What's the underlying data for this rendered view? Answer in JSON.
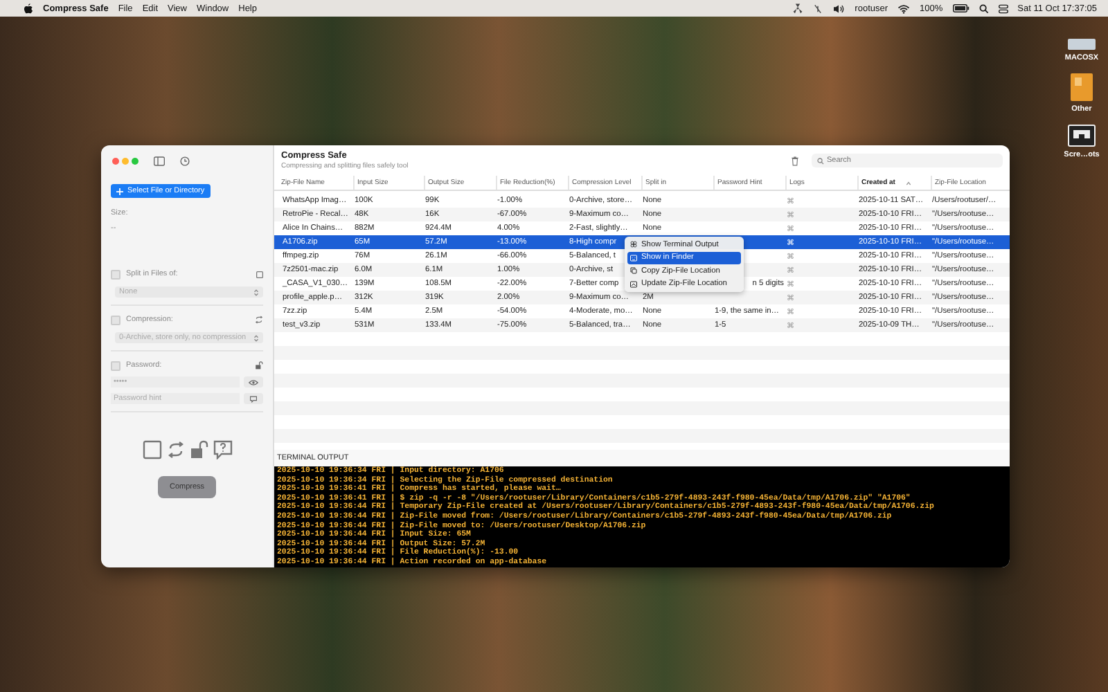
{
  "menubar": {
    "app_name": "Compress Safe",
    "menus": [
      "File",
      "Edit",
      "View",
      "Window",
      "Help"
    ],
    "user": "rootuser",
    "battery": "100%",
    "clock": "Sat 11 Oct  17:37:05"
  },
  "desktop_icons": [
    {
      "label": "MACOSX"
    },
    {
      "label": "Other"
    },
    {
      "label": "Scre…ots"
    }
  ],
  "sidebar": {
    "select_button": "Select File or Directory",
    "size_label": "Size:",
    "size_value": "--",
    "options": [
      {
        "kind": "dropdown",
        "label": "Split in Files of:",
        "checked": false,
        "value": "None"
      },
      {
        "kind": "dropdown",
        "label": "Compression:",
        "checked": false,
        "value": "0-Archive, store only, no compression"
      },
      {
        "kind": "password",
        "label": "Password:",
        "checked": false,
        "placeholder": "•••••",
        "hint_placeholder": "Password hint"
      }
    ],
    "compress_button": {
      "label": "Compress",
      "disabled": true
    }
  },
  "main": {
    "title": "Compress Safe",
    "subtitle": "Compressing and splitting files safely tool",
    "search": {
      "placeholder": "Search"
    },
    "columns": [
      {
        "label": "Zip-File Name",
        "sorted": false
      },
      {
        "label": "Input Size",
        "sorted": false
      },
      {
        "label": "Output Size",
        "sorted": false
      },
      {
        "label": "File Reduction(%)",
        "sorted": false
      },
      {
        "label": "Compression Level",
        "sorted": false
      },
      {
        "label": "Split in",
        "sorted": false
      },
      {
        "label": "Password Hint",
        "sorted": false
      },
      {
        "label": "Logs",
        "sorted": false
      },
      {
        "label": "Created at",
        "sorted": true
      },
      {
        "label": "Zip-File Location",
        "sorted": false
      }
    ],
    "rows": [
      {
        "selected": false,
        "cells": [
          "WhatsApp Imag…",
          "100K",
          "99K",
          "-1.00%",
          "0-Archive, store…",
          "None",
          null,
          "⌘",
          "2025-10-11 SAT…",
          "/Users/rootuser/…"
        ]
      },
      {
        "selected": false,
        "cells": [
          "RetroPie - Recal…",
          "48K",
          "16K",
          "-67.00%",
          "9-Maximum co…",
          "None",
          null,
          "⌘",
          "2025-10-10 FRI…",
          "\"/Users/rootuse…"
        ]
      },
      {
        "selected": false,
        "cells": [
          "Alice In Chains…",
          "882M",
          "924.4M",
          "4.00%",
          "2-Fast, slightly…",
          "None",
          null,
          "⌘",
          "2025-10-10 FRI…",
          "\"/Users/rootuse…"
        ]
      },
      {
        "selected": true,
        "cells": [
          "A1706.zip",
          "65M",
          "57.2M",
          "-13.00%",
          "8-High compr",
          null,
          null,
          "⌘",
          "2025-10-10 FRI…",
          "\"/Users/rootuse…"
        ]
      },
      {
        "selected": false,
        "cells": [
          "ffmpeg.zip",
          "76M",
          "26.1M",
          "-66.00%",
          "5-Balanced, t",
          null,
          null,
          "⌘",
          "2025-10-10 FRI…",
          "\"/Users/rootuse…"
        ]
      },
      {
        "selected": false,
        "cells": [
          "7z2501-mac.zip",
          "6.0M",
          "6.1M",
          "1.00%",
          "0-Archive, st",
          null,
          null,
          "⌘",
          "2025-10-10 FRI…",
          "\"/Users/rootuse…"
        ]
      },
      {
        "selected": false,
        "cells": [
          "_CASA_V1_030…",
          "139M",
          "108.5M",
          "-22.00%",
          "7-Better comp",
          null,
          "n 5 digits",
          "⌘",
          "2025-10-10 FRI…",
          "\"/Users/rootuse…"
        ]
      },
      {
        "selected": false,
        "cells": [
          "profile_apple.p…",
          "312K",
          "319K",
          "2.00%",
          "9-Maximum co…",
          "2M",
          null,
          "⌘",
          "2025-10-10 FRI…",
          "\"/Users/rootuse…"
        ]
      },
      {
        "selected": false,
        "cells": [
          "7zz.zip",
          "5.4M",
          "2.5M",
          "-54.00%",
          "4-Moderate, mo…",
          "None",
          "1-9, the same in…",
          "⌘",
          "2025-10-10 FRI…",
          "\"/Users/rootuse…"
        ]
      },
      {
        "selected": false,
        "cells": [
          "test_v3.zip",
          "531M",
          "133.4M",
          "-75.00%",
          "5-Balanced, tra…",
          "None",
          "1-5",
          "⌘",
          "2025-10-09 TH…",
          "\"/Users/rootuse…"
        ]
      }
    ],
    "context_menu": [
      {
        "label": "Show Terminal Output",
        "selected": false
      },
      {
        "label": "Show in Finder",
        "selected": true
      },
      {
        "label": "Copy Zip-File Location",
        "selected": false
      },
      {
        "label": "Update Zip-File Location",
        "selected": false
      }
    ],
    "terminal": {
      "label": "TERMINAL OUTPUT",
      "lines": [
        "2025-10-10 19:36:34 FRI | Input directory: A1706",
        "2025-10-10 19:36:34 FRI | Selecting the Zip-File compressed destination",
        "2025-10-10 19:36:41 FRI | Compress has started, please wait…",
        "2025-10-10 19:36:41 FRI | $ zip -q -r -8 \"/Users/rootuser/Library/Containers/c1b5-279f-4893-243f-f980-45ea/Data/tmp/A1706.zip\" \"A1706\"",
        "2025-10-10 19:36:44 FRI | Temporary Zip-File created at /Users/rootuser/Library/Containers/c1b5-279f-4893-243f-f980-45ea/Data/tmp/A1706.zip",
        "2025-10-10 19:36:44 FRI | Zip-File moved from: /Users/rootuser/Library/Containers/c1b5-279f-4893-243f-f980-45ea/Data/tmp/A1706.zip",
        "2025-10-10 19:36:44 FRI | Zip-File moved to: /Users/rootuser/Desktop/A1706.zip",
        "2025-10-10 19:36:44 FRI | Input Size: 65M",
        "2025-10-10 19:36:44 FRI | Output Size: 57.2M",
        "2025-10-10 19:36:44 FRI | File Reduction(%): -13.00",
        "2025-10-10 19:36:44 FRI | Action recorded on app-database"
      ]
    }
  }
}
